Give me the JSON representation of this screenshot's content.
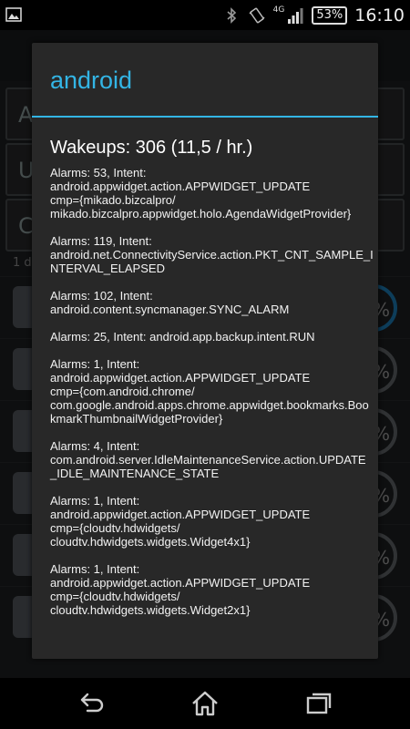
{
  "status_bar": {
    "network_type": "4G",
    "battery": "53%",
    "time": "16:10",
    "icons": [
      "gallery-icon",
      "bluetooth-icon",
      "vibrate-icon",
      "signal-icon",
      "battery-icon"
    ]
  },
  "background": {
    "field_1": "A",
    "field_2": "U",
    "field_3": "C",
    "small_text": "1 d",
    "ring_pct": "%"
  },
  "dialog": {
    "title": "android",
    "heading": "Wakeups: 306 (11,5 / hr.)",
    "entries": [
      {
        "l1": "Alarms: 53, Intent:",
        "l2": "android.appwidget.action.APPWIDGET_UPDATE",
        "l3": "cmp={mikado.bizcalpro/",
        "l4": "mikado.bizcalpro.appwidget.holo.AgendaWidgetProvider}"
      },
      {
        "l1": "Alarms: 119, Intent:",
        "l2": "android.net.ConnectivityService.action.PKT_CNT_SAMPLE_I",
        "l3": "NTERVAL_ELAPSED"
      },
      {
        "l1": "Alarms: 102, Intent:",
        "l2": "android.content.syncmanager.SYNC_ALARM"
      },
      {
        "l1": "Alarms: 25, Intent: android.app.backup.intent.RUN"
      },
      {
        "l1": "Alarms: 1, Intent:",
        "l2": "android.appwidget.action.APPWIDGET_UPDATE",
        "l3": "cmp={com.android.chrome/",
        "l4": "com.google.android.apps.chrome.appwidget.bookmarks.Boo",
        "l5": "kmarkThumbnailWidgetProvider}"
      },
      {
        "l1": "Alarms: 4, Intent:",
        "l2": "com.android.server.IdleMaintenanceService.action.UPDATE",
        "l3": "_IDLE_MAINTENANCE_STATE"
      },
      {
        "l1": "Alarms: 1, Intent:",
        "l2": "android.appwidget.action.APPWIDGET_UPDATE",
        "l3": "cmp={cloudtv.hdwidgets/",
        "l4": "cloudtv.hdwidgets.widgets.Widget4x1}"
      },
      {
        "l1": "Alarms: 1, Intent:",
        "l2": "android.appwidget.action.APPWIDGET_UPDATE",
        "l3": "cmp={cloudtv.hdwidgets/",
        "l4": "cloudtv.hdwidgets.widgets.Widget2x1}"
      }
    ]
  },
  "nav_bar": {
    "icons": [
      "back-icon",
      "home-icon",
      "recent-apps-icon"
    ]
  },
  "colors": {
    "accent": "#33b5e5",
    "dialog_bg": "#282828"
  }
}
